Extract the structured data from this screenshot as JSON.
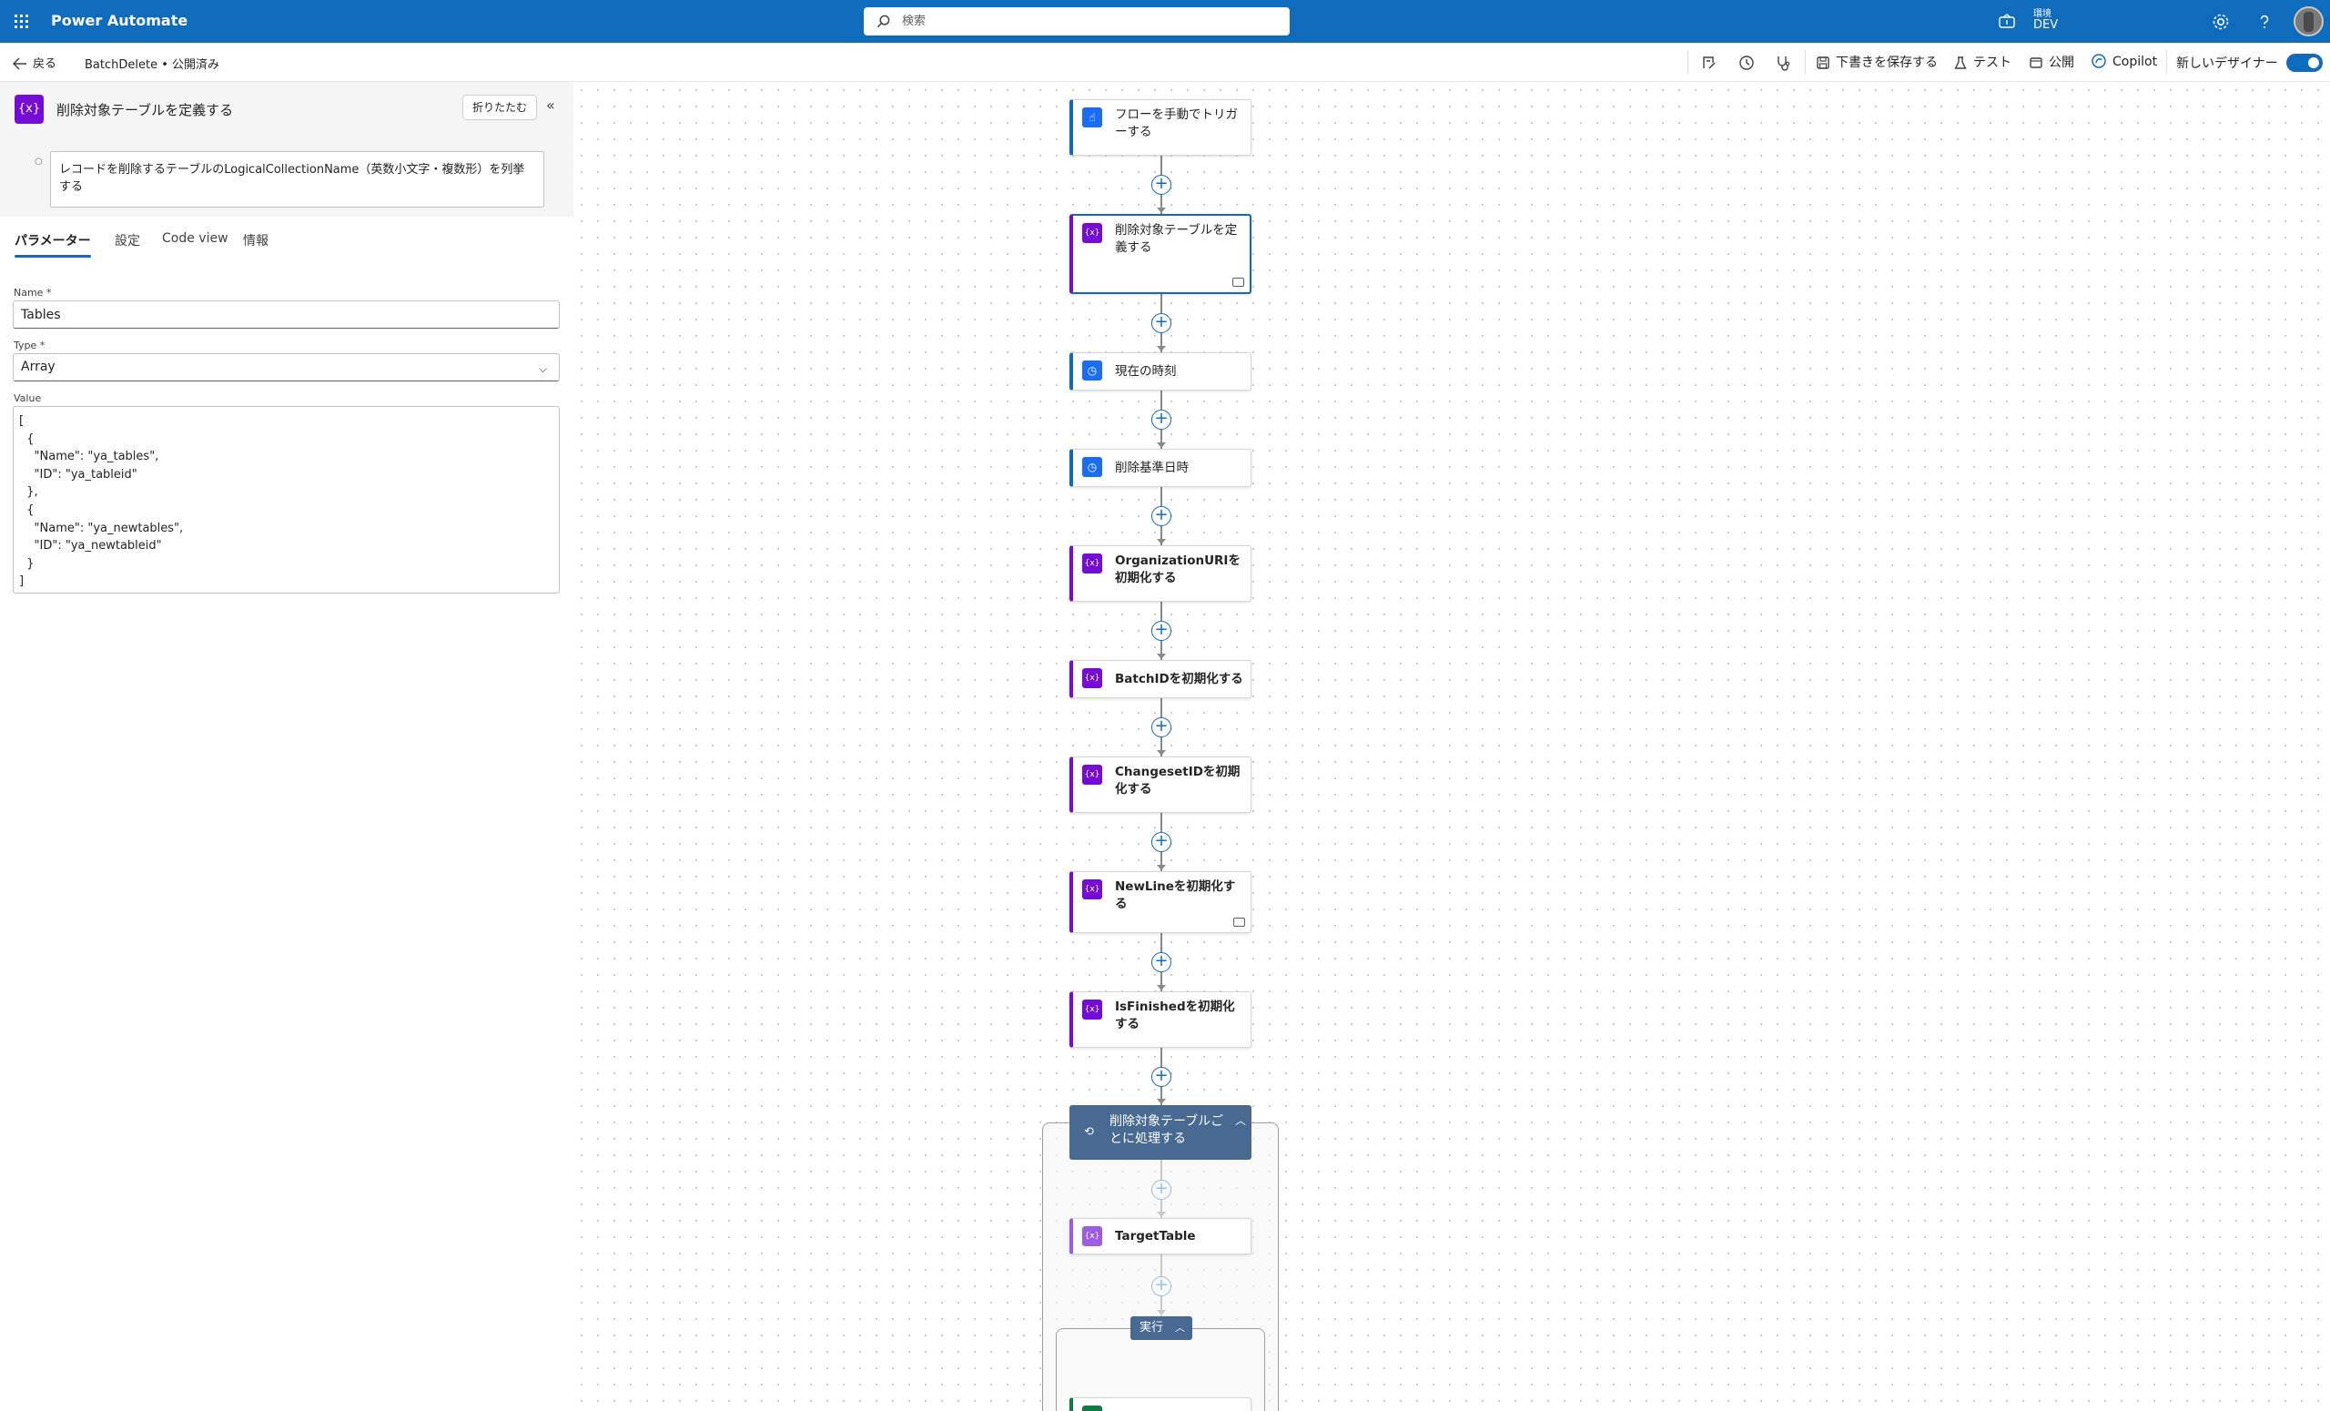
{
  "header": {
    "app_title": "Power Automate",
    "search_placeholder": "検索",
    "environment_label": "環境",
    "environment_name": "DEV"
  },
  "command_bar": {
    "back_label": "戻る",
    "breadcrumb": "BatchDelete • 公開済み",
    "save_draft": "下書きを保存する",
    "test": "テスト",
    "publish": "公開",
    "copilot": "Copilot",
    "new_designer": "新しいデザイナー",
    "new_designer_on": true
  },
  "panel": {
    "title": "削除対象テーブルを定義する",
    "collapse_button": "折りたたむ",
    "description": "レコードを削除するテーブルのLogicalCollectionName（英数小文字・複数形）を列挙する",
    "tabs": [
      "パラメーター",
      "設定",
      "Code view",
      "情報"
    ],
    "active_tab": "パラメーター",
    "name_label": "Name *",
    "name_value": "Tables",
    "type_label": "Type *",
    "type_value": "Array",
    "value_label": "Value",
    "value_text": "[\n  {\n    \"Name\": \"ya_tables\",\n    \"ID\": \"ya_tableid\"\n  },\n  {\n    \"Name\": \"ya_newtables\",\n    \"ID\": \"ya_newtableid\"\n  }\n]"
  },
  "flow": {
    "steps": [
      {
        "label": "フローを手動でトリガーする",
        "icon": "manual-trigger-icon"
      },
      {
        "label": "削除対象テーブルを定義する",
        "icon": "variable-icon"
      },
      {
        "label": "現在の時刻",
        "icon": "clock-icon"
      },
      {
        "label": "削除基準日時",
        "icon": "clock-icon"
      },
      {
        "label": "OrganizationURIを初期化する",
        "icon": "variable-icon"
      },
      {
        "label": "BatchIDを初期化する",
        "icon": "variable-icon"
      },
      {
        "label": "ChangesetIDを初期化する",
        "icon": "variable-icon"
      },
      {
        "label": "NewLineを初期化する",
        "icon": "variable-icon"
      },
      {
        "label": "IsFinishedを初期化する",
        "icon": "variable-icon"
      }
    ],
    "loop_label": "削除対象テーブルごとに処理する",
    "loop_inner_step": "TargetTable",
    "run_label": "実行"
  }
}
